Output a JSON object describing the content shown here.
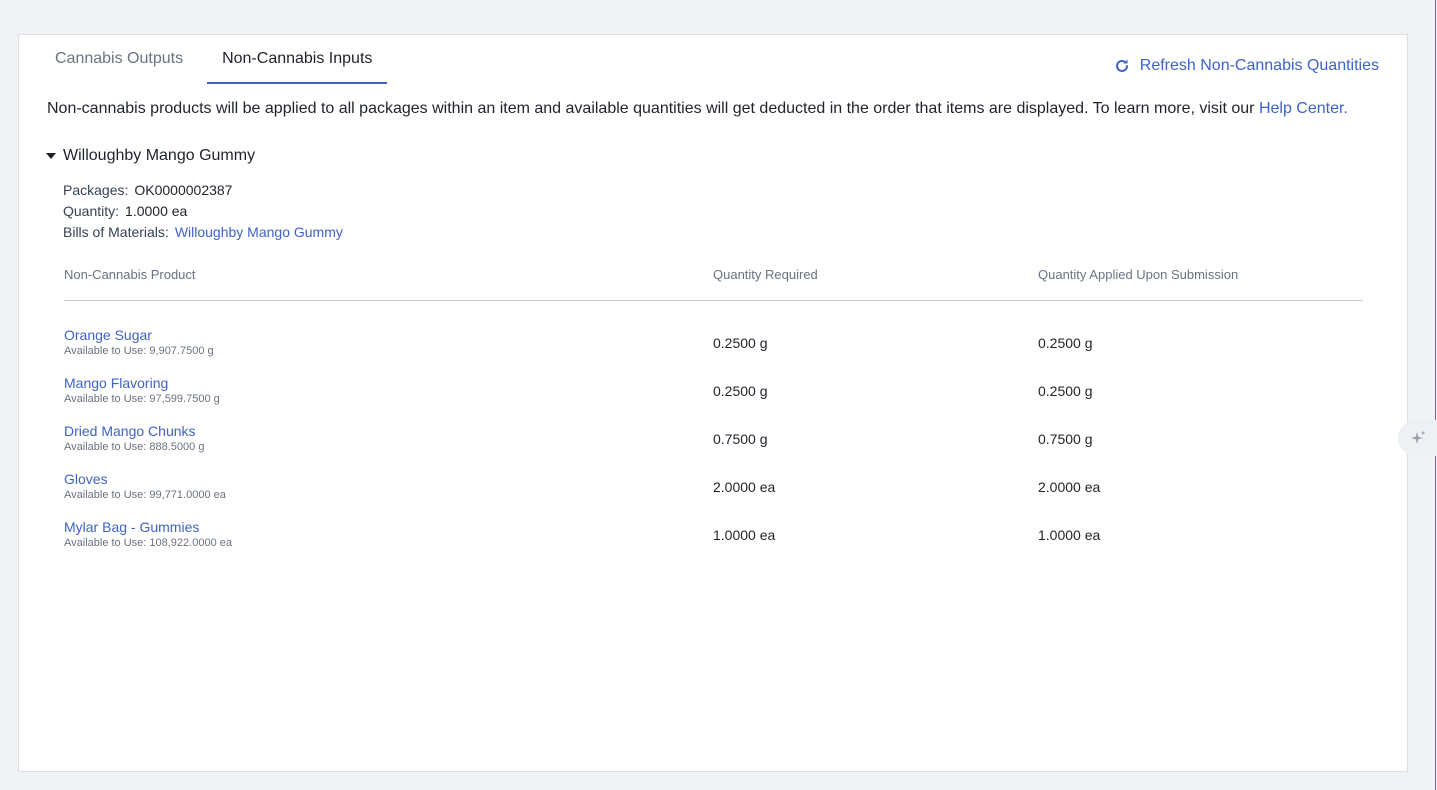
{
  "tabs": [
    {
      "label": "Cannabis Outputs",
      "active": false
    },
    {
      "label": "Non-Cannabis Inputs",
      "active": true
    }
  ],
  "refresh_label": "Refresh Non-Cannabis Quantities",
  "intro": {
    "text": "Non-cannabis products will be applied to all packages within an item and available quantities will get deducted in the order that items are displayed. To learn more, visit our ",
    "link": "Help Center."
  },
  "item": {
    "title": "Willoughby Mango Gummy",
    "packages_label": "Packages:",
    "packages_value": "OK0000002387",
    "quantity_label": "Quantity:",
    "quantity_value": "1.0000 ea",
    "bom_label": "Bills of Materials:",
    "bom_value": "Willoughby Mango Gummy"
  },
  "table": {
    "headers": [
      "Non-Cannabis Product",
      "Quantity Required",
      "Quantity Applied Upon Submission"
    ],
    "rows": [
      {
        "name": "Orange Sugar",
        "available": "Available to Use: 9,907.7500 g",
        "required": "0.2500 g",
        "applied": "0.2500 g"
      },
      {
        "name": "Mango Flavoring",
        "available": "Available to Use: 97,599.7500 g",
        "required": "0.2500 g",
        "applied": "0.2500 g"
      },
      {
        "name": "Dried Mango Chunks",
        "available": "Available to Use: 888.5000 g",
        "required": "0.7500 g",
        "applied": "0.7500 g"
      },
      {
        "name": "Gloves",
        "available": "Available to Use: 99,771.0000 ea",
        "required": "2.0000 ea",
        "applied": "2.0000 ea"
      },
      {
        "name": "Mylar Bag - Gummies",
        "available": "Available to Use: 108,922.0000 ea",
        "required": "1.0000 ea",
        "applied": "1.0000 ea"
      }
    ]
  },
  "icons": {
    "refresh": "refresh-icon",
    "caret": "caret-down-icon",
    "sparkle": "sparkle-icon"
  },
  "colors": {
    "accent": "#3e63c6",
    "text": "#1f2329",
    "muted": "#6b7280"
  }
}
